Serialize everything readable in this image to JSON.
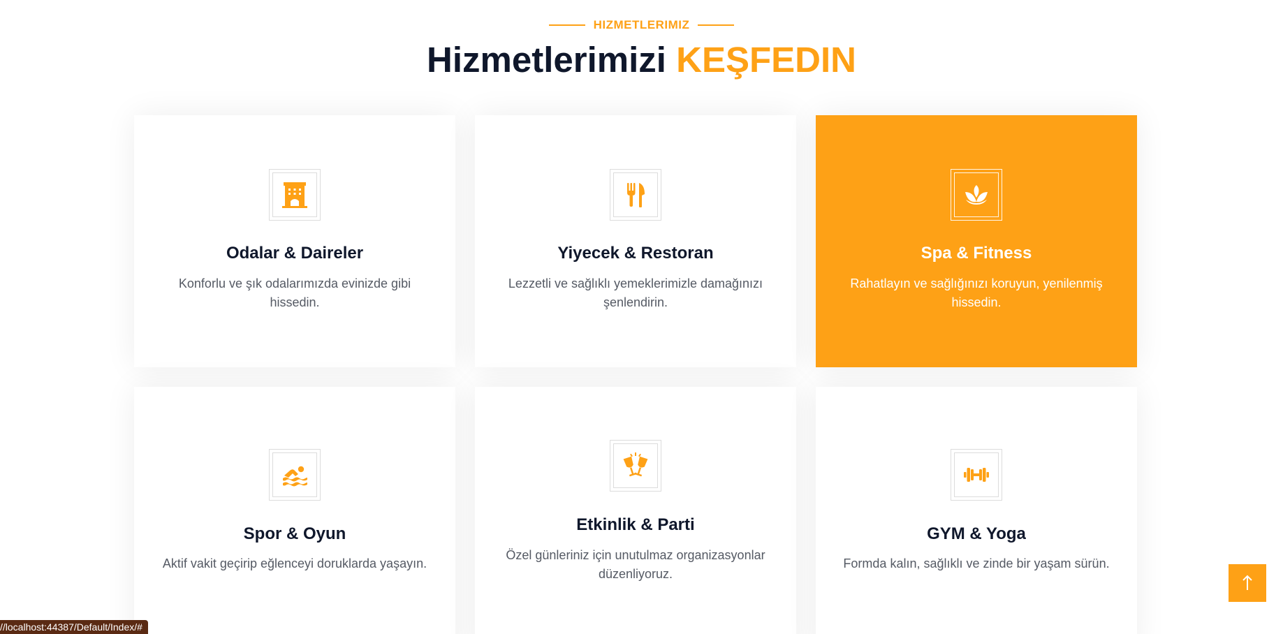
{
  "section": {
    "eyebrow": "HIZMETLERIMIZ",
    "headline_main": "Hizmetlerimizi",
    "headline_accent": "KEŞFEDIN"
  },
  "services": [
    {
      "icon": "hotel-icon",
      "title": "Odalar & Daireler",
      "description": "Konforlu ve şık odalarımızda evinizde gibi hissedin.",
      "active": false
    },
    {
      "icon": "utensils-icon",
      "title": "Yiyecek & Restoran",
      "description": "Lezzetli ve sağlıklı yemeklerimizle damağınızı şenlendirin.",
      "active": false
    },
    {
      "icon": "spa-lotus-icon",
      "title": "Spa & Fitness",
      "description": "Rahatlayın ve sağlığınızı koruyun, yenilenmiş hissedin.",
      "active": true
    },
    {
      "icon": "swimmer-icon",
      "title": "Spor & Oyun",
      "description": "Aktif vakit geçirip eğlenceyi doruklarda yaşayın.",
      "active": false
    },
    {
      "icon": "glass-cheers-icon",
      "title": "Etkinlik & Parti",
      "description": "Özel günleriniz için unutulmaz organizasyonlar düzenliyoruz.",
      "active": false
    },
    {
      "icon": "dumbbell-icon",
      "title": "GYM & Yoga",
      "description": "Formda kalın, sağlıklı ve zinde bir yaşam sürün.",
      "active": false
    }
  ],
  "back_to_top": {
    "icon": "arrow-up-icon"
  },
  "status_bar": {
    "url": "//localhost:44387/Default/Index/#"
  },
  "colors": {
    "accent": "#FEA116",
    "heading": "#0F172B",
    "body_text": "#555a64"
  }
}
